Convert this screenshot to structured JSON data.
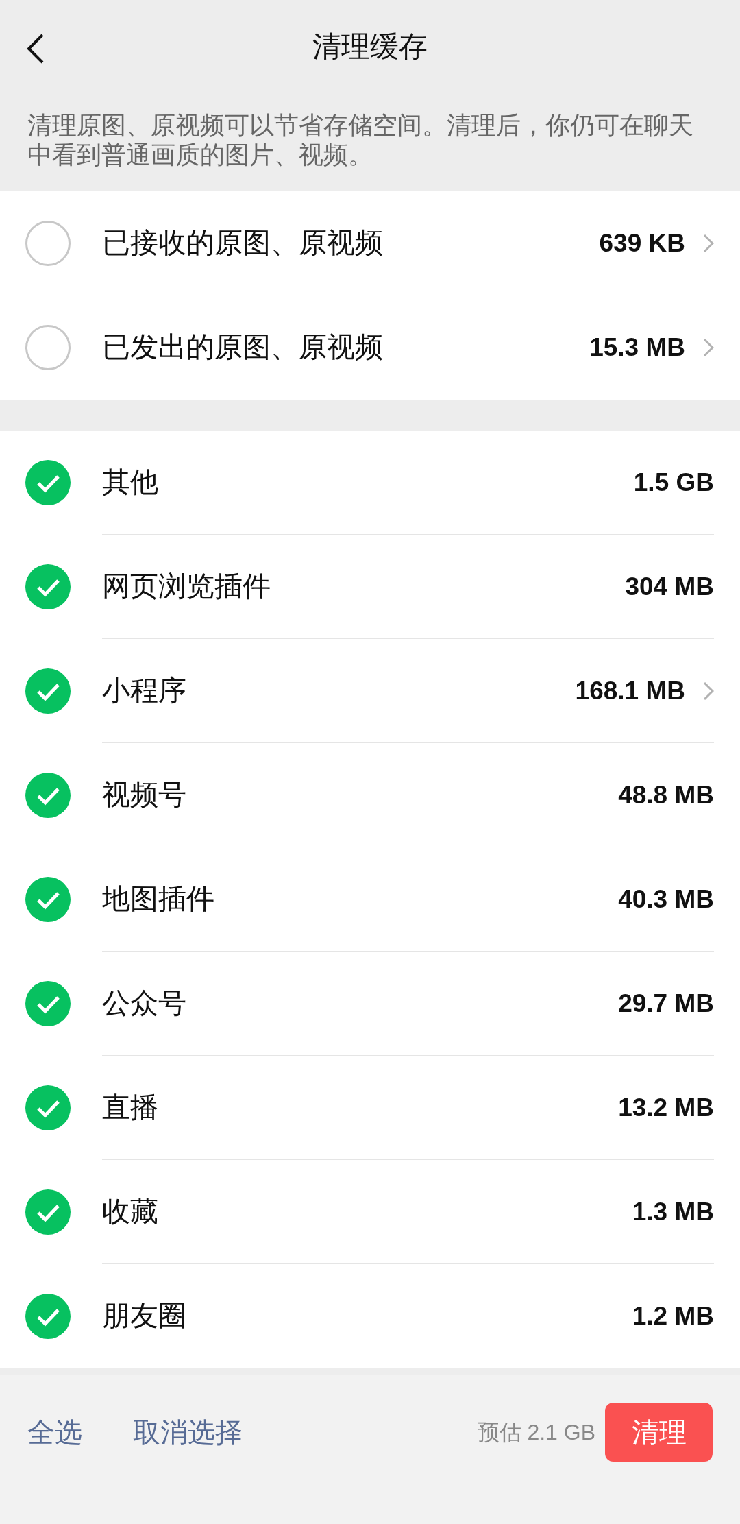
{
  "header": {
    "title": "清理缓存"
  },
  "description": "清理原图、原视频可以节省存储空间。清理后，你仍可在聊天中看到普通画质的图片、视频。",
  "groups": [
    {
      "items": [
        {
          "label": "已接收的原图、原视频",
          "size": "639 KB",
          "checked": false,
          "arrow": true
        },
        {
          "label": "已发出的原图、原视频",
          "size": "15.3 MB",
          "checked": false,
          "arrow": true
        }
      ]
    },
    {
      "items": [
        {
          "label": "其他",
          "size": "1.5 GB",
          "checked": true,
          "arrow": false
        },
        {
          "label": "网页浏览插件",
          "size": "304 MB",
          "checked": true,
          "arrow": false
        },
        {
          "label": "小程序",
          "size": "168.1 MB",
          "checked": true,
          "arrow": true
        },
        {
          "label": "视频号",
          "size": "48.8 MB",
          "checked": true,
          "arrow": false
        },
        {
          "label": "地图插件",
          "size": "40.3 MB",
          "checked": true,
          "arrow": false
        },
        {
          "label": "公众号",
          "size": "29.7 MB",
          "checked": true,
          "arrow": false
        },
        {
          "label": "直播",
          "size": "13.2 MB",
          "checked": true,
          "arrow": false
        },
        {
          "label": "收藏",
          "size": "1.3 MB",
          "checked": true,
          "arrow": false
        },
        {
          "label": "朋友圈",
          "size": "1.2 MB",
          "checked": true,
          "arrow": false
        }
      ]
    }
  ],
  "bottom_bar": {
    "select_all": "全选",
    "deselect": "取消选择",
    "estimate": "预估 2.1 GB",
    "clean_button": "清理"
  }
}
